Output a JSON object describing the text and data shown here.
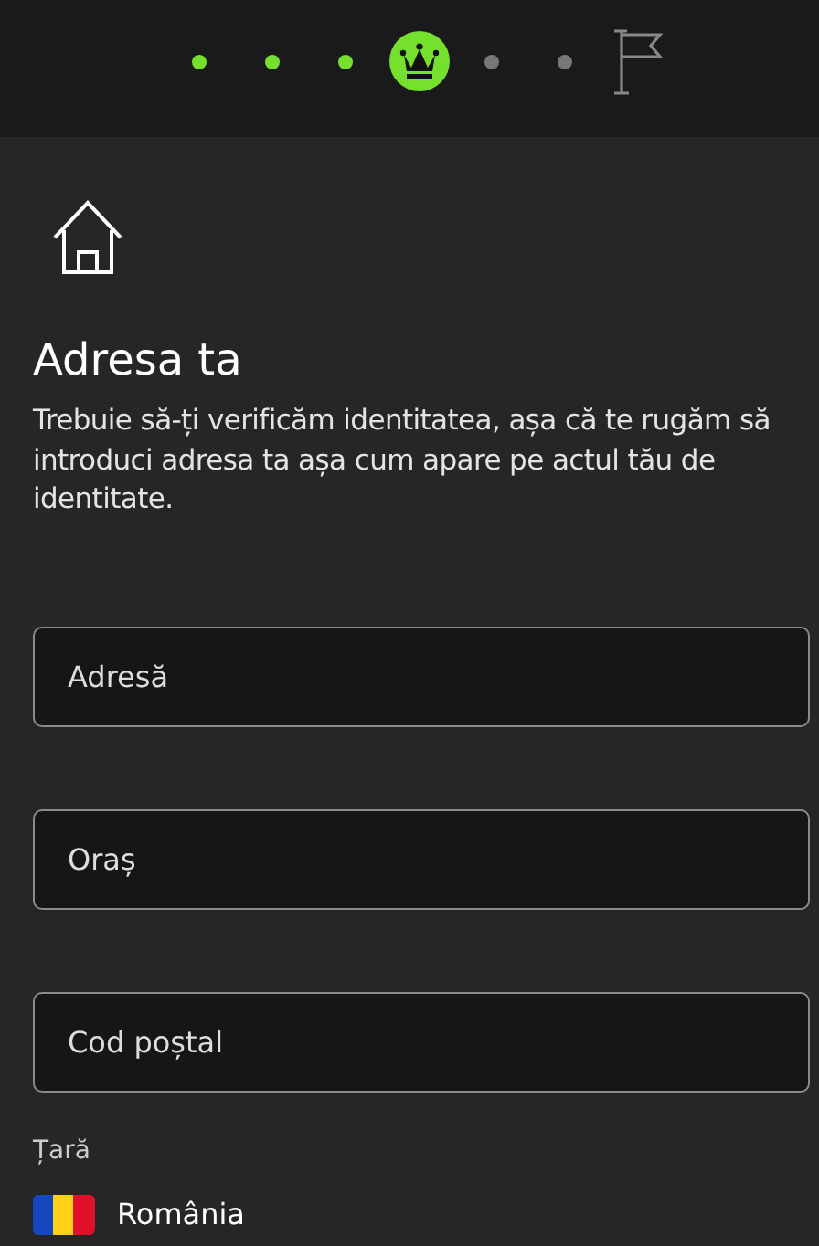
{
  "progress": {
    "steps": [
      {
        "kind": "dot",
        "done": true
      },
      {
        "kind": "dot",
        "done": true
      },
      {
        "kind": "dot",
        "done": true
      },
      {
        "kind": "crown",
        "done": true
      },
      {
        "kind": "dot",
        "done": false
      },
      {
        "kind": "dot",
        "done": false
      },
      {
        "kind": "flag",
        "done": false
      }
    ]
  },
  "title": "Adresa ta",
  "description": "Trebuie să-ți verificăm identitatea, așa că te rugăm să introduci adresa ta așa cum apare pe actul tău de identitate.",
  "fields": [
    {
      "placeholder": "Adresă"
    },
    {
      "placeholder": "Oraș"
    },
    {
      "placeholder": "Cod poștal"
    }
  ],
  "country": {
    "label": "Țară",
    "value": "România"
  }
}
